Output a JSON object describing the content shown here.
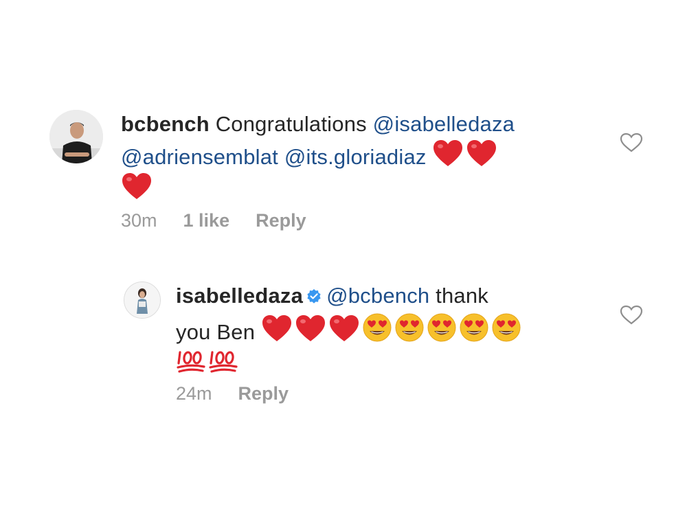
{
  "comments": [
    {
      "username": "bcbench",
      "text": "Congratulations",
      "mentions": [
        "@isabelledaza",
        "@adriensemblat",
        "@its.gloriadiaz"
      ],
      "emojis": [
        "red-heart",
        "red-heart",
        "red-heart"
      ],
      "time": "30m",
      "likes": "1 like",
      "reply": "Reply"
    },
    {
      "username": "isabelledaza",
      "verified": true,
      "mention": "@bcbench",
      "text_line1": "thank",
      "text_line2": "you Ben",
      "emojis": [
        "red-heart",
        "red-heart",
        "red-heart",
        "heart-eyes",
        "heart-eyes",
        "heart-eyes",
        "heart-eyes",
        "heart-eyes",
        "hundred-points",
        "hundred-points"
      ],
      "time": "24m",
      "reply": "Reply"
    }
  ],
  "colors": {
    "mention": "#1f4f8a",
    "meta": "#9a9a9a",
    "text": "#262626",
    "heart": "#e0262f",
    "verified": "#3897f0"
  }
}
